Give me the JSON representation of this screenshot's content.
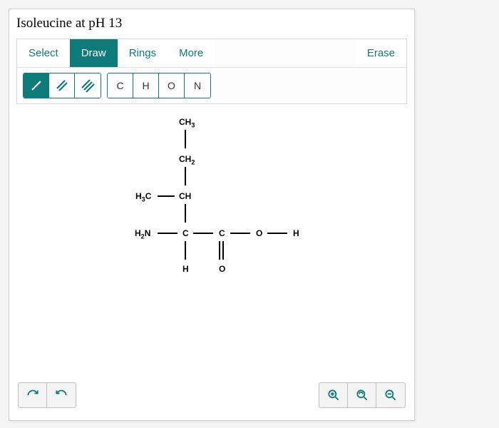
{
  "title": "Isoleucine at pH 13",
  "tabs": {
    "select": "Select",
    "draw": "Draw",
    "rings": "Rings",
    "more": "More",
    "erase": "Erase"
  },
  "atoms": {
    "c": "C",
    "h": "H",
    "o": "O",
    "n": "N"
  },
  "structure": {
    "ch3": "CH",
    "ch3_sub": "3",
    "ch2": "CH",
    "ch2_sub": "2",
    "h3c": "H",
    "h3c_sub": "3",
    "h3c_suffix": "C",
    "ch": "CH",
    "h2n": "H",
    "h2n_sub": "2",
    "h2n_suffix": "N",
    "c_center": "C",
    "c_right": "C",
    "o_right": "O",
    "h_right": "H",
    "h_bottom": "H",
    "o_bottom": "O"
  }
}
